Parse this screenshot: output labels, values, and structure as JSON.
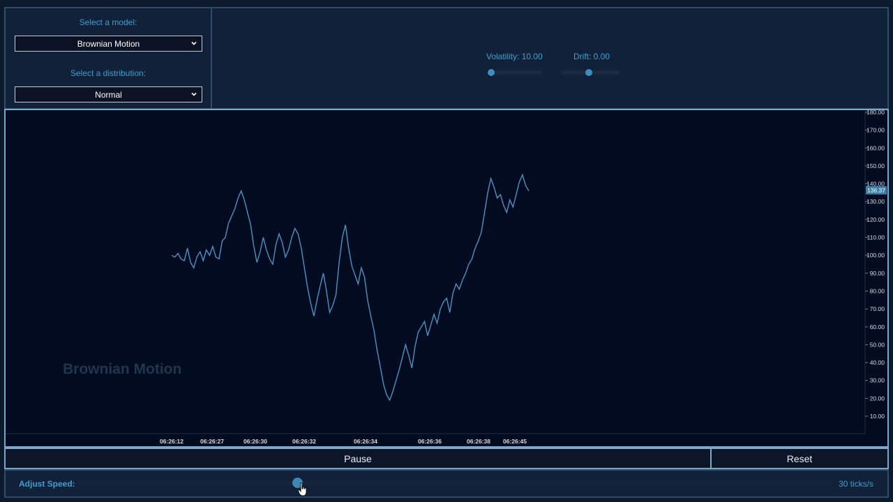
{
  "controls": {
    "model_label": "Select a model:",
    "model_value": "Brownian Motion",
    "distribution_label": "Select a distribution:",
    "distribution_value": "Normal",
    "volatility_label": "Volatility: 10.00",
    "volatility_level": 0.0,
    "drift_label": "Drift: 0.00",
    "drift_level": 0.5
  },
  "chart": {
    "watermark": "Brownian Motion",
    "last_price_label": "136.37"
  },
  "chart_data": {
    "type": "line",
    "title": "",
    "xlabel": "",
    "ylabel": "",
    "ylim": [
      0,
      180
    ],
    "yticks": [
      "180.00",
      "170.00",
      "160.00",
      "150.00",
      "140.00",
      "130.00",
      "120.00",
      "110.00",
      "100.00",
      "90.00",
      "80.00",
      "70.00",
      "60.00",
      "50.00",
      "40.00",
      "30.00",
      "20.00",
      "10.00"
    ],
    "x_tick_labels": [
      "06:26:12",
      "06:26:27",
      "06:26:30",
      "06:26:32",
      "06:26:34",
      "06:26:36",
      "06:26:38",
      "06:26:45"
    ],
    "last_value": 136.37,
    "series": [
      {
        "color": "#4a93c4",
        "values": [
          100,
          99,
          101,
          98,
          97,
          104,
          96,
          93,
          99,
          102,
          97,
          103,
          100,
          105,
          99,
          98,
          108,
          110,
          118,
          122,
          126,
          132,
          136,
          131,
          124,
          117,
          105,
          96,
          102,
          110,
          103,
          98,
          95,
          106,
          112,
          107,
          99,
          103,
          110,
          115,
          112,
          104,
          93,
          82,
          73,
          66,
          75,
          83,
          90,
          80,
          68,
          72,
          78,
          96,
          110,
          117,
          104,
          94,
          89,
          84,
          93,
          88,
          75,
          66,
          58,
          47,
          38,
          28,
          22,
          19,
          24,
          30,
          36,
          43,
          50,
          44,
          37,
          49,
          57,
          60,
          63,
          55,
          61,
          67,
          62,
          70,
          74,
          76,
          68,
          79,
          84,
          81,
          86,
          90,
          95,
          98,
          104,
          108,
          113,
          124,
          135,
          143,
          138,
          132,
          134,
          128,
          124,
          131,
          127,
          134,
          141,
          145,
          139,
          136
        ]
      }
    ]
  },
  "actions": {
    "pause_label": "Pause",
    "reset_label": "Reset"
  },
  "speed": {
    "label": "Adjust Speed:",
    "value_label": "30 ticks/s",
    "level": 0.29
  },
  "icons": {
    "dropdown": "chevron-down-icon",
    "cursor": "hand-pointer-icon"
  }
}
